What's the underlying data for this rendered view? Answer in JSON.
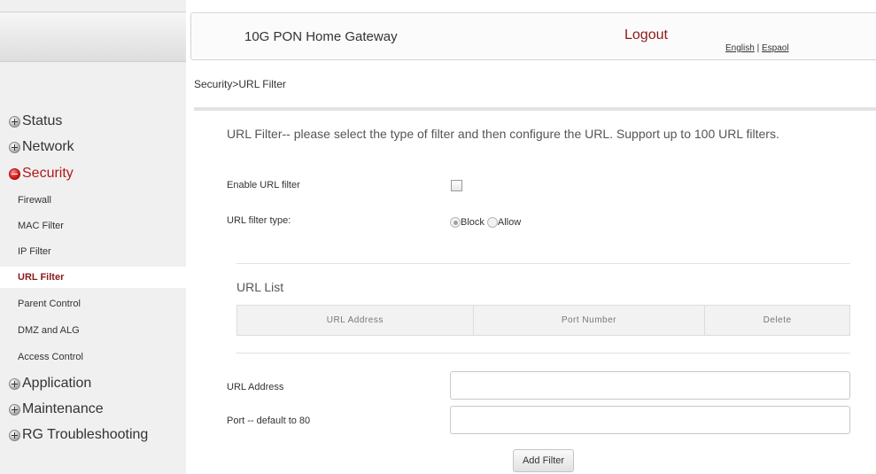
{
  "header": {
    "title": "10G PON Home Gateway",
    "logout": "Logout",
    "lang_english": "English",
    "lang_separator": " | ",
    "lang_spanish": "Espaol"
  },
  "breadcrumb": "Security>URL Filter",
  "sidebar": {
    "sections": [
      {
        "label": "Status",
        "expanded": false
      },
      {
        "label": "Network",
        "expanded": false
      },
      {
        "label": "Security",
        "expanded": true
      },
      {
        "label": "Application",
        "expanded": false
      },
      {
        "label": "Maintenance",
        "expanded": false
      },
      {
        "label": "RG Troubleshooting",
        "expanded": false
      }
    ],
    "security_items": [
      {
        "label": "Firewall"
      },
      {
        "label": "MAC Filter"
      },
      {
        "label": "IP Filter"
      },
      {
        "label": "URL Filter",
        "selected": true
      },
      {
        "label": "Parent Control"
      },
      {
        "label": "DMZ and ALG"
      },
      {
        "label": "Access Control"
      }
    ]
  },
  "main": {
    "intro": "URL Filter-- please select the type of filter and then configure the URL. Support up to 100 URL filters.",
    "enable_label": "Enable URL filter",
    "enable_checked": false,
    "filter_type_label": "URL filter type:",
    "filter_type_options": [
      "Block",
      "Allow"
    ],
    "filter_type_selected": "Block",
    "url_list_title": "URL List",
    "table_headers": [
      "URL Address",
      "Port Number",
      "Delete"
    ],
    "url_address_label": "URL Address",
    "url_address_value": "",
    "port_label": "Port -- default to 80",
    "port_value": "",
    "add_button": "Add Filter"
  },
  "colors": {
    "accent": "#8b1a1a",
    "active_section": "#b11a1a",
    "sidebar_bg": "#f0f0f0"
  }
}
